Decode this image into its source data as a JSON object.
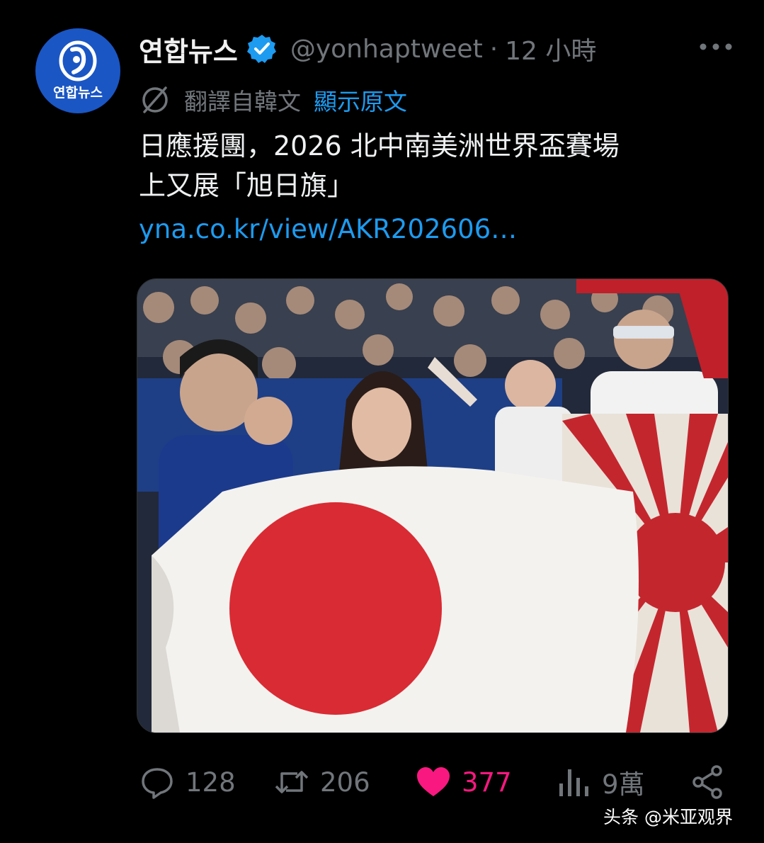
{
  "tweet": {
    "author": {
      "display_name": "연합뉴스",
      "handle": "@yonhaptweet",
      "avatar_text": "연합뉴스",
      "verified": true,
      "avatar_color": "#1a56c4"
    },
    "separator": "·",
    "time": "12 小時",
    "translation": {
      "label": "翻譯自韓文",
      "show_original": "顯示原文"
    },
    "text": "日應援團，2026 北中南美洲世界盃賽場\n上又展「旭日旗」",
    "link": "yna.co.kr/view/AKR202606…",
    "stats": {
      "replies": "128",
      "retweets": "206",
      "likes": "377",
      "views": "9萬"
    }
  },
  "watermark": "头条 @米亚观界",
  "colors": {
    "background": "#000000",
    "accent": "#1d9bf0",
    "muted": "#71767b",
    "like": "#f91880",
    "verified": "#1d9bf0"
  },
  "icons": [
    "more-icon",
    "verified-badge-icon",
    "translate-icon",
    "reply-icon",
    "retweet-icon",
    "like-icon",
    "views-icon",
    "share-icon"
  ]
}
